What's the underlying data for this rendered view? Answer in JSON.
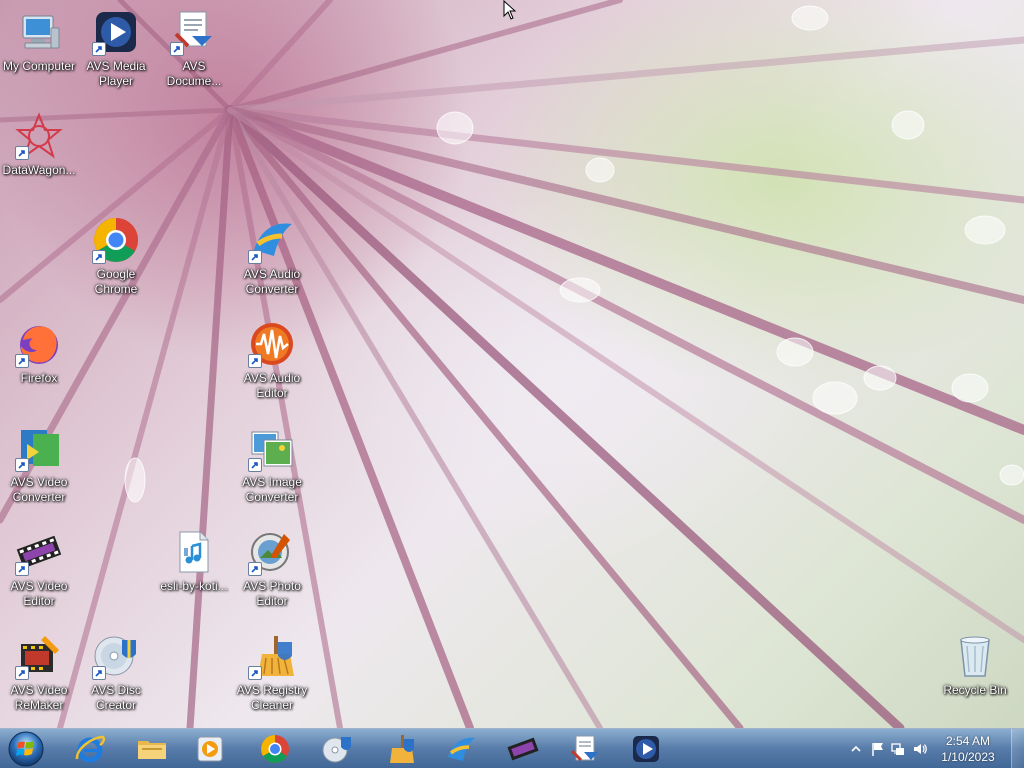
{
  "desktop": {
    "icons": [
      {
        "id": "my-computer",
        "label": "My Computer",
        "shortcut": false
      },
      {
        "id": "avs-media-player",
        "label": "AVS Media Player",
        "shortcut": true
      },
      {
        "id": "avs-document",
        "label": "AVS Docume...",
        "shortcut": true
      },
      {
        "id": "datawagon",
        "label": "DataWagon...",
        "shortcut": true
      },
      {
        "id": "google-chrome",
        "label": "Google Chrome",
        "shortcut": true
      },
      {
        "id": "avs-audio-converter",
        "label": "AVS Audio Converter",
        "shortcut": true
      },
      {
        "id": "firefox",
        "label": "Firefox",
        "shortcut": true
      },
      {
        "id": "avs-audio-editor",
        "label": "AVS Audio Editor",
        "shortcut": true
      },
      {
        "id": "avs-video-converter",
        "label": "AVS Video Converter",
        "shortcut": true
      },
      {
        "id": "avs-image-converter",
        "label": "AVS Image Converter",
        "shortcut": true
      },
      {
        "id": "avs-video-editor",
        "label": "AVS Video Editor",
        "shortcut": true
      },
      {
        "id": "esli-by-koti",
        "label": "esli-by-koti...",
        "shortcut": false
      },
      {
        "id": "avs-photo-editor",
        "label": "AVS Photo Editor",
        "shortcut": true
      },
      {
        "id": "avs-video-remaker",
        "label": "AVS Video ReMaker",
        "shortcut": true
      },
      {
        "id": "avs-disc-creator",
        "label": "AVS Disc Creator",
        "shortcut": true
      },
      {
        "id": "avs-registry-cleaner",
        "label": "AVS Registry Cleaner",
        "shortcut": true
      },
      {
        "id": "recycle-bin",
        "label": "Recycle Bin",
        "shortcut": false
      }
    ]
  },
  "taskbar": {
    "pinned": [
      {
        "id": "internet-explorer",
        "icon": "internet-explorer-icon"
      },
      {
        "id": "file-explorer",
        "icon": "folder-icon"
      },
      {
        "id": "media-player",
        "icon": "media-player-icon"
      },
      {
        "id": "chrome",
        "icon": "chrome-icon"
      },
      {
        "id": "disc-creator",
        "icon": "disc-creator-icon"
      },
      {
        "id": "registry-cleaner",
        "icon": "registry-cleaner-icon"
      },
      {
        "id": "audio-converter",
        "icon": "audio-converter-icon"
      },
      {
        "id": "video-editor",
        "icon": "video-editor-icon"
      },
      {
        "id": "document-converter",
        "icon": "document-converter-icon"
      },
      {
        "id": "avs-media-player",
        "icon": "avs-media-player-icon"
      }
    ],
    "tray": {
      "time": "2:54 AM",
      "date": "1/10/2023"
    }
  },
  "colors": {
    "taskbar": "#4a78a8",
    "label_text": "#ffffff"
  }
}
